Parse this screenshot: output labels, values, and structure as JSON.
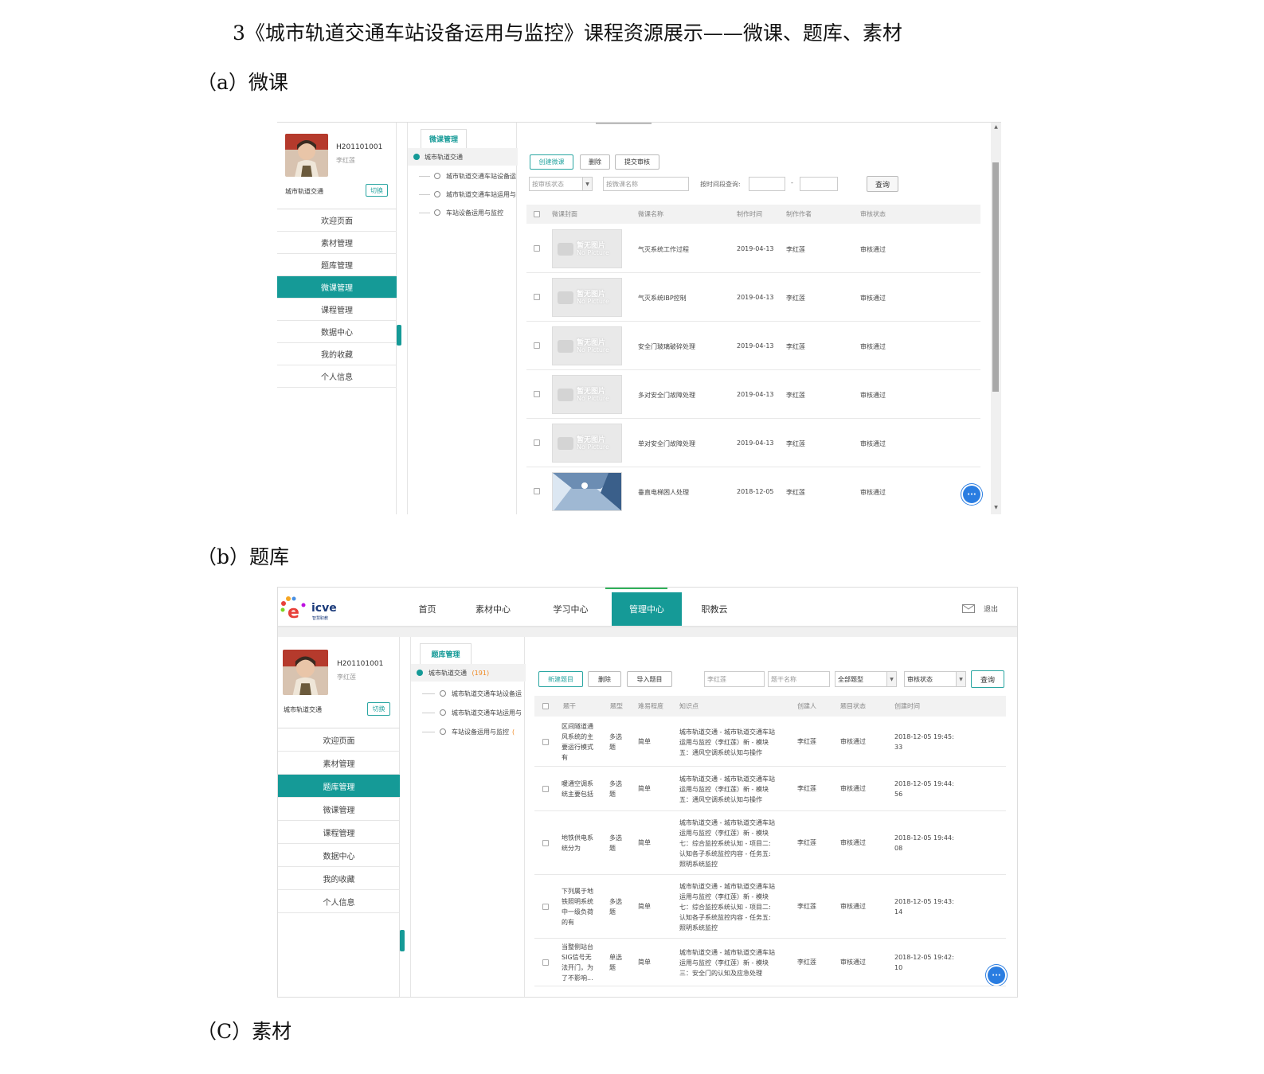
{
  "doc": {
    "title": "3《城市轨道交通车站设备运用与监控》课程资源展示——微课、题库、素材",
    "section_a": "（a）微课",
    "section_b": "（b）题库",
    "section_c": "（C）素材"
  },
  "shotA": {
    "user_id": "H201101001",
    "user_name": "李红莲",
    "course": "城市轨道交通",
    "switch_label": "切换",
    "menu": [
      "欢迎页面",
      "素材管理",
      "题库管理",
      "微课管理",
      "课程管理",
      "数据中心",
      "我的收藏",
      "个人信息"
    ],
    "active_menu_index": 3,
    "tree_tab": "微课管理",
    "tree_root": "城市轨道交通",
    "tree_items": [
      "城市轨道交通车站设备运",
      "城市轨道交通车站运用与",
      "车站设备运用与监控"
    ],
    "buttons": {
      "create": "创建微课",
      "delete": "删除",
      "submit": "提交审核",
      "query": "查询"
    },
    "filters": {
      "status_placeholder": "按审核状态",
      "name_placeholder": "按微课名称",
      "time_label": "按时间段查询:",
      "dash": "-"
    },
    "headers": [
      "微课封面",
      "微课名称",
      "制作时间",
      "制作作者",
      "审核状态"
    ],
    "thumb_text": {
      "cn": "暂无图片",
      "en": "No Picture"
    },
    "rows": [
      {
        "name": "气灭系统工作过程",
        "date": "2019-04-13",
        "author": "李红莲",
        "status": "审核通过"
      },
      {
        "name": "气灭系统IBP控制",
        "date": "2019-04-13",
        "author": "李红莲",
        "status": "审核通过"
      },
      {
        "name": "安全门玻璃破碎处理",
        "date": "2019-04-13",
        "author": "李红莲",
        "status": "审核通过"
      },
      {
        "name": "多对安全门故障处理",
        "date": "2019-04-13",
        "author": "李红莲",
        "status": "审核通过"
      },
      {
        "name": "单对安全门故障处理",
        "date": "2019-04-13",
        "author": "李红莲",
        "status": "审核通过"
      },
      {
        "name": "垂直电梯困人处理",
        "date": "2018-12-05",
        "author": "李红莲",
        "status": "审核通过"
      }
    ]
  },
  "shotB": {
    "logo": "icve",
    "logo_sub": "智慧职教",
    "nav": [
      "首页",
      "素材中心",
      "学习中心",
      "管理中心",
      "职教云"
    ],
    "active_nav_index": 3,
    "logout": "退出",
    "user_id": "H201101001",
    "user_name": "李红莲",
    "course": "城市轨道交通",
    "switch_label": "切换",
    "menu": [
      "欢迎页面",
      "素材管理",
      "题库管理",
      "微课管理",
      "课程管理",
      "数据中心",
      "我的收藏",
      "个人信息"
    ],
    "active_menu_index": 2,
    "tree_tab": "题库管理",
    "tree_root": "城市轨道交通",
    "tree_root_count": "(191)",
    "tree_items": [
      "城市轨道交通车站设备运",
      "城市轨道交通车站运用与",
      "车站设备运用与监控"
    ],
    "tree_item_suffix": "(",
    "buttons": {
      "create": "新建题目",
      "delete": "删除",
      "import": "导入题目",
      "query": "查询"
    },
    "filters": {
      "creator_value": "李红莲",
      "name_placeholder": "题干名称",
      "type_value": "全部题型",
      "status_value": "审核状态"
    },
    "headers": [
      "题干",
      "题型",
      "难易程度",
      "知识点",
      "创建人",
      "题目状态",
      "创建时间"
    ],
    "rows": [
      {
        "stem": [
          "区间隧道通",
          "风系统的主",
          "要运行模式",
          "有"
        ],
        "type": [
          "多选",
          "题"
        ],
        "level": "简单",
        "kp": [
          "城市轨道交通 - 城市轨道交通车站",
          "运用与监控（李红莲）新 - 模块",
          "五：通风空调系统认知与操作"
        ],
        "creator": "李红莲",
        "status": "审核通过",
        "time": [
          "2018-12-05 19:45:",
          "33"
        ]
      },
      {
        "stem": [
          "暖通空调系",
          "统主要包括"
        ],
        "type": [
          "多选",
          "题"
        ],
        "level": "简单",
        "kp": [
          "城市轨道交通 - 城市轨道交通车站",
          "运用与监控（李红莲）新 - 模块",
          "五：通风空调系统认知与操作"
        ],
        "creator": "李红莲",
        "status": "审核通过",
        "time": [
          "2018-12-05 19:44:",
          "56"
        ]
      },
      {
        "stem": [
          "地铁供电系",
          "统分为"
        ],
        "type": [
          "多选",
          "题"
        ],
        "level": "简单",
        "kp": [
          "城市轨道交通 - 城市轨道交通车站",
          "运用与监控（李红莲）新 - 模块",
          "七：综合监控系统认知 - 项目二:",
          "认知各子系统监控内容 - 任务五:",
          "照明系统监控"
        ],
        "creator": "李红莲",
        "status": "审核通过",
        "time": [
          "2018-12-05 19:44:",
          "08"
        ]
      },
      {
        "stem": [
          "下列属于地",
          "铁照明系统",
          "中一级负荷",
          "的有"
        ],
        "type": [
          "多选",
          "题"
        ],
        "level": "简单",
        "kp": [
          "城市轨道交通 - 城市轨道交通车站",
          "运用与监控（李红莲）新 - 模块",
          "七：综合监控系统认知 - 项目二:",
          "认知各子系统监控内容 - 任务五:",
          "照明系统监控"
        ],
        "creator": "李红莲",
        "status": "审核通过",
        "time": [
          "2018-12-05 19:43:",
          "14"
        ]
      },
      {
        "stem": [
          "当整侧站台",
          "SIG信号无",
          "法开门，为",
          "了不影响..."
        ],
        "type": [
          "单选",
          "题"
        ],
        "level": "简单",
        "kp": [
          "城市轨道交通 - 城市轨道交通车站",
          "运用与监控（李红莲）新 - 模块",
          "三：安全门的认知及应急处理"
        ],
        "creator": "李红莲",
        "status": "审核通过",
        "time": [
          "2018-12-05 19:42:",
          "10"
        ]
      }
    ]
  }
}
